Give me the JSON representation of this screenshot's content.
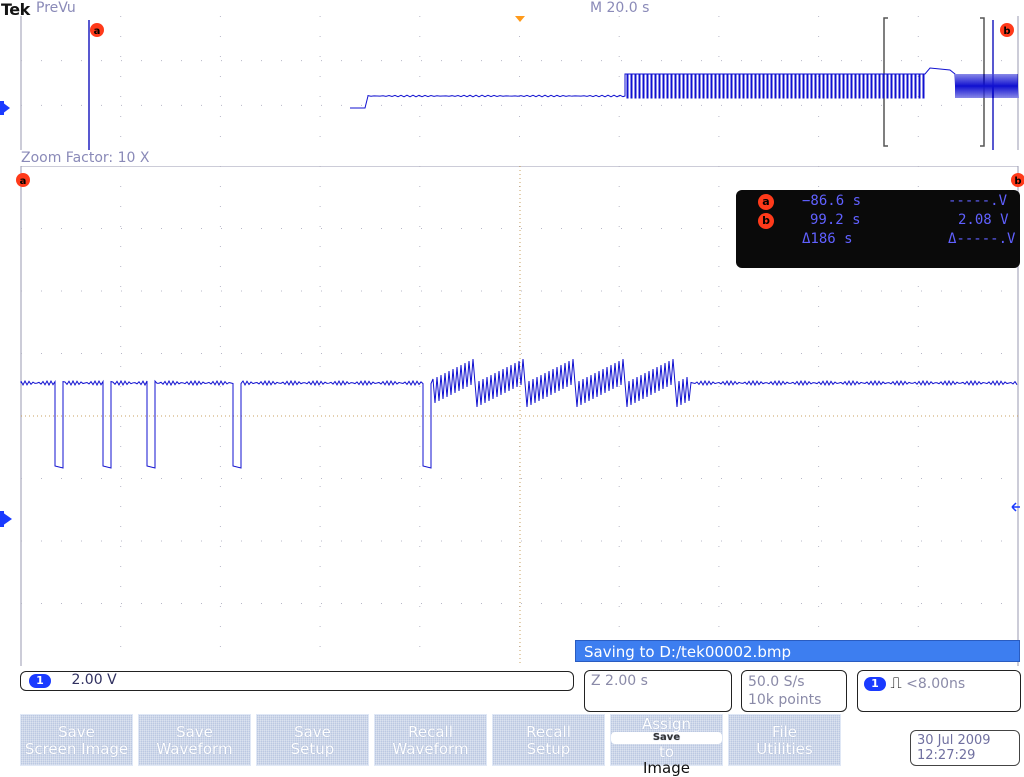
{
  "header": {
    "logo": "Tek",
    "mode": "PreVu",
    "timebase": "M 20.0 s"
  },
  "overview": {
    "cursor_a": "a",
    "cursor_b": "b"
  },
  "zoom": {
    "factor_label": "Zoom Factor: 10 X",
    "cursor_a": "a",
    "cursor_b": "b"
  },
  "cursors": {
    "a_badge": "a",
    "b_badge": "b",
    "a_time": "−86.6 s",
    "a_volt": "-----.V",
    "b_time": "99.2 s",
    "b_volt": "2.08 V",
    "delta_time": "Δ186 s",
    "delta_volt": "Δ-----.V"
  },
  "status": {
    "saving": "Saving to D:/tek00002.bmp"
  },
  "readouts": {
    "ch1_num": "1",
    "ch1_scale": "2.00 V",
    "zoom_scale": "Z 2.00 s",
    "sample_rate": "50.0 S/s",
    "record_length": "10k points",
    "trig_ch": "1",
    "trig_symbol": "⎍",
    "trig_value": "<8.00ns"
  },
  "menu": [
    {
      "line1": "Save",
      "line2": "Screen Image"
    },
    {
      "line1": "Save",
      "line2": "Waveform"
    },
    {
      "line1": "Save",
      "line2": "Setup"
    },
    {
      "line1": "Recall",
      "line2": "Waveform"
    },
    {
      "line1": "Recall",
      "line2": "Setup"
    },
    {
      "line1": "Assign",
      "chip": "Save",
      "line2": "to",
      "line3": "Image"
    },
    {
      "line1": "File",
      "line2": "Utilities"
    }
  ],
  "datetime": {
    "date": "30 Jul  2009",
    "time": "12:27:29"
  },
  "colors": {
    "trace": "#1010d0",
    "cursor": "#ff3a1a",
    "grid": "#b8b8c8"
  },
  "icons": {
    "ch1_ground_marker": "ch1-ground-marker-icon",
    "trigger_marker": "trigger-marker-icon"
  }
}
